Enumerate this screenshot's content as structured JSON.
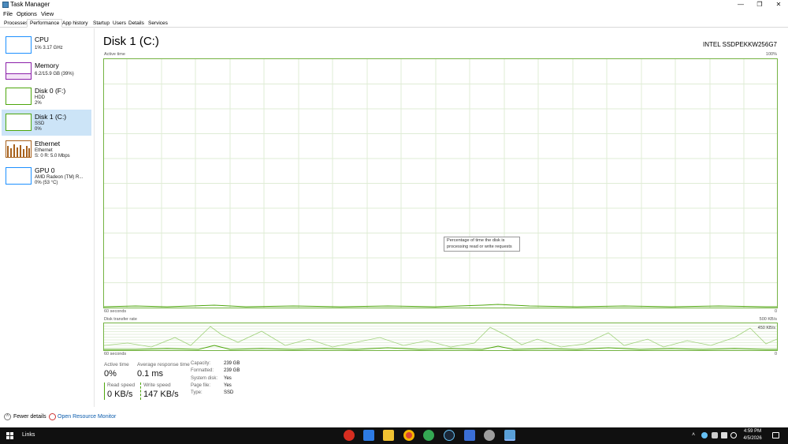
{
  "window": {
    "title": "Task Manager",
    "controls": {
      "minimize": "—",
      "restore": "❐",
      "close": "✕"
    }
  },
  "menu": [
    "File",
    "Options",
    "View"
  ],
  "tabs": [
    "Processes",
    "Performance",
    "App history",
    "Startup",
    "Users",
    "Details",
    "Services"
  ],
  "sidebar": [
    {
      "name": "CPU",
      "line1": "1% 3.17 GHz",
      "line2": "",
      "line3": "",
      "color": "#1e90ff"
    },
    {
      "name": "Memory",
      "line1": "6.2/15.9 GB (39%)",
      "line2": "",
      "line3": "",
      "color": "#8b1fa9"
    },
    {
      "name": "Disk 0 (F:)",
      "line1": "HDD",
      "line2": "2%",
      "line3": "",
      "color": "#4da60c"
    },
    {
      "name": "Disk 1 (C:)",
      "line1": "SSD",
      "line2": "0%",
      "line3": "",
      "color": "#4da60c"
    },
    {
      "name": "Ethernet",
      "line1": "Ethernet",
      "line2": "S: 0 R: 5.0 Mbps",
      "line3": "",
      "color": "#a7611c"
    },
    {
      "name": "GPU 0",
      "line1": "AMD Radeon (TM) R...",
      "line2": "0% (53 °C)",
      "line3": "",
      "color": "#1e90ff"
    }
  ],
  "main": {
    "title": "Disk 1 (C:)",
    "model": "INTEL SSDPEKKW256G7",
    "active_graph": {
      "label": "Active time",
      "max": "100%",
      "time": "60 seconds",
      "min": "0"
    },
    "transfer_graph": {
      "label": "Disk transfer rate",
      "max": "500 KB/s",
      "inner": "450 KB/s",
      "time": "60 seconds",
      "min": "0"
    },
    "tooltip": "Percentage of time the disk is processing read or write requests",
    "stats": {
      "active_time_label": "Active time",
      "active_time_value": "0%",
      "response_label": "Average response time",
      "response_value": "0.1 ms",
      "read_label": "Read speed",
      "read_value": "0 KB/s",
      "write_label": "Write speed",
      "write_value": "147 KB/s"
    },
    "properties": [
      {
        "key": "Capacity:",
        "value": "239 GB"
      },
      {
        "key": "Formatted:",
        "value": "239 GB"
      },
      {
        "key": "System disk:",
        "value": "Yes"
      },
      {
        "key": "Page file:",
        "value": "Yes"
      },
      {
        "key": "Type:",
        "value": "SSD"
      }
    ]
  },
  "footer": {
    "fewer_details": "Fewer details",
    "resource_monitor": "Open Resource Monitor"
  },
  "taskbar": {
    "links": "Links",
    "time": "4:59 PM",
    "date": "4/5/2026"
  }
}
